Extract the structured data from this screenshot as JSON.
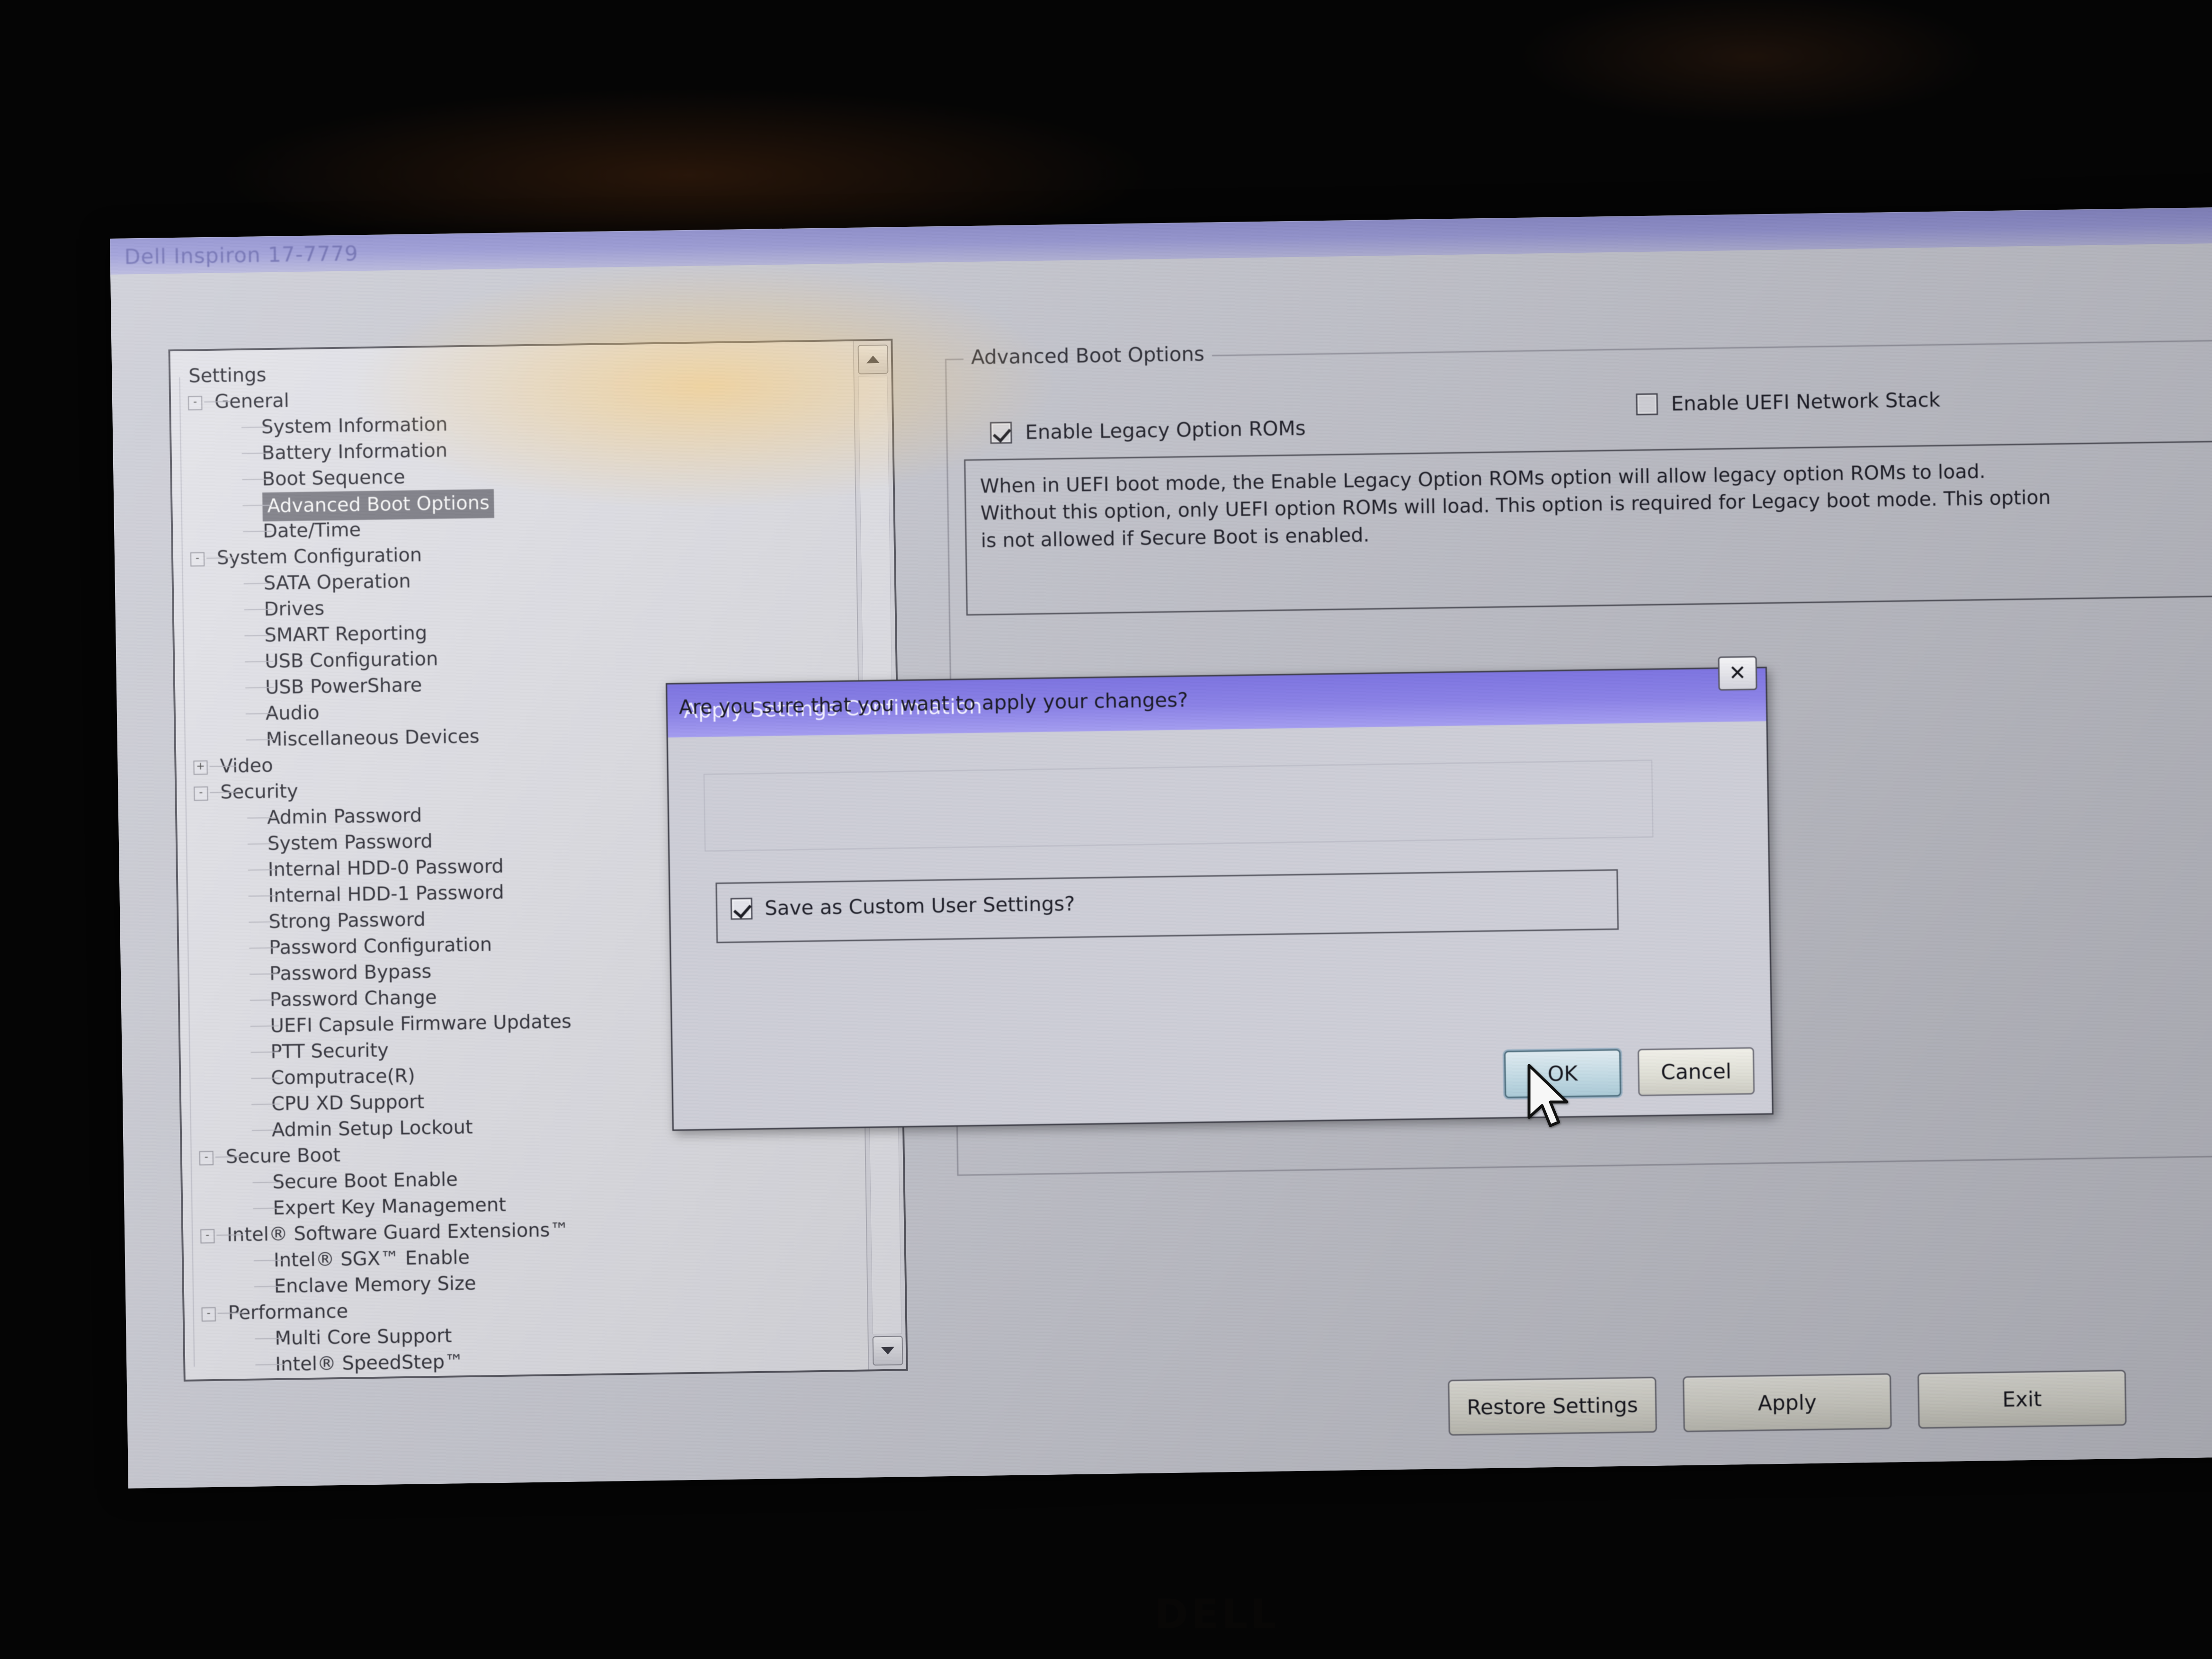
{
  "window": {
    "title": "Dell Inspiron 17-7779"
  },
  "tree": {
    "root_label": "Settings",
    "items": [
      {
        "label": "Settings",
        "level": 0,
        "expander": "",
        "selected": false
      },
      {
        "label": "General",
        "level": 1,
        "expander": "-",
        "selected": false
      },
      {
        "label": "System Information",
        "level": 2,
        "expander": "",
        "selected": false
      },
      {
        "label": "Battery Information",
        "level": 2,
        "expander": "",
        "selected": false
      },
      {
        "label": "Boot Sequence",
        "level": 2,
        "expander": "",
        "selected": false
      },
      {
        "label": "Advanced Boot Options",
        "level": 2,
        "expander": "",
        "selected": true
      },
      {
        "label": "Date/Time",
        "level": 2,
        "expander": "",
        "selected": false
      },
      {
        "label": "System Configuration",
        "level": 1,
        "expander": "-",
        "selected": false
      },
      {
        "label": "SATA Operation",
        "level": 2,
        "expander": "",
        "selected": false
      },
      {
        "label": "Drives",
        "level": 2,
        "expander": "",
        "selected": false
      },
      {
        "label": "SMART Reporting",
        "level": 2,
        "expander": "",
        "selected": false
      },
      {
        "label": "USB Configuration",
        "level": 2,
        "expander": "",
        "selected": false
      },
      {
        "label": "USB PowerShare",
        "level": 2,
        "expander": "",
        "selected": false
      },
      {
        "label": "Audio",
        "level": 2,
        "expander": "",
        "selected": false
      },
      {
        "label": "Miscellaneous Devices",
        "level": 2,
        "expander": "",
        "selected": false
      },
      {
        "label": "Video",
        "level": 1,
        "expander": "+",
        "selected": false
      },
      {
        "label": "Security",
        "level": 1,
        "expander": "-",
        "selected": false
      },
      {
        "label": "Admin Password",
        "level": 2,
        "expander": "",
        "selected": false
      },
      {
        "label": "System Password",
        "level": 2,
        "expander": "",
        "selected": false
      },
      {
        "label": "Internal HDD-0 Password",
        "level": 2,
        "expander": "",
        "selected": false
      },
      {
        "label": "Internal HDD-1 Password",
        "level": 2,
        "expander": "",
        "selected": false
      },
      {
        "label": "Strong Password",
        "level": 2,
        "expander": "",
        "selected": false
      },
      {
        "label": "Password Configuration",
        "level": 2,
        "expander": "",
        "selected": false
      },
      {
        "label": "Password Bypass",
        "level": 2,
        "expander": "",
        "selected": false
      },
      {
        "label": "Password Change",
        "level": 2,
        "expander": "",
        "selected": false
      },
      {
        "label": "UEFI Capsule Firmware Updates",
        "level": 2,
        "expander": "",
        "selected": false
      },
      {
        "label": "PTT Security",
        "level": 2,
        "expander": "",
        "selected": false
      },
      {
        "label": "Computrace(R)",
        "level": 2,
        "expander": "",
        "selected": false
      },
      {
        "label": "CPU XD Support",
        "level": 2,
        "expander": "",
        "selected": false
      },
      {
        "label": "Admin Setup Lockout",
        "level": 2,
        "expander": "",
        "selected": false
      },
      {
        "label": "Secure Boot",
        "level": 1,
        "expander": "-",
        "selected": false
      },
      {
        "label": "Secure Boot Enable",
        "level": 2,
        "expander": "",
        "selected": false
      },
      {
        "label": "Expert Key Management",
        "level": 2,
        "expander": "",
        "selected": false
      },
      {
        "label": "Intel® Software Guard Extensions™",
        "level": 1,
        "expander": "-",
        "selected": false
      },
      {
        "label": "Intel® SGX™ Enable",
        "level": 2,
        "expander": "",
        "selected": false
      },
      {
        "label": "Enclave Memory Size",
        "level": 2,
        "expander": "",
        "selected": false
      },
      {
        "label": "Performance",
        "level": 1,
        "expander": "-",
        "selected": false
      },
      {
        "label": "Multi Core Support",
        "level": 2,
        "expander": "",
        "selected": false
      },
      {
        "label": "Intel® SpeedStep™",
        "level": 2,
        "expander": "",
        "selected": false
      }
    ],
    "scroll_up_icon": "scroll-up-arrow-icon",
    "scroll_down_icon": "scroll-down-arrow-icon"
  },
  "content": {
    "group_title": "Advanced Boot Options",
    "checkboxes": [
      {
        "label": "Enable Legacy Option ROMs",
        "checked": true
      },
      {
        "label": "Enable UEFI Network Stack",
        "checked": false
      }
    ],
    "description_lines": [
      "When in UEFI boot mode, the Enable Legacy Option ROMs option will allow legacy option ROMs to load.",
      "Without this option, only UEFI option ROMs will load. This option is required for Legacy boot mode. This option",
      "is not allowed if Secure Boot is enabled."
    ]
  },
  "footer": {
    "buttons": [
      {
        "label": "Restore Settings"
      },
      {
        "label": "Apply"
      },
      {
        "label": "Exit"
      }
    ]
  },
  "dialog": {
    "title": "Apply Settings Confirmation",
    "close_icon": "✕",
    "message": "Are you sure that you want to apply your changes?",
    "checkbox": {
      "label": "Save as Custom User Settings?",
      "checked": true
    },
    "buttons": [
      {
        "label": "OK",
        "focused": true
      },
      {
        "label": "Cancel",
        "focused": false
      }
    ]
  },
  "hardware": {
    "brand_logo": "DELL"
  },
  "colors": {
    "dialog_titlebar": "#7d74e0",
    "window_titlebar": "#9a9ad8",
    "panel_background": "#cdced7",
    "tree_background": "#e4e4ea",
    "tree_selection": "#7c7c85",
    "focused_button": "#bfd8e2",
    "screen_glare": "#ffcd6e"
  }
}
